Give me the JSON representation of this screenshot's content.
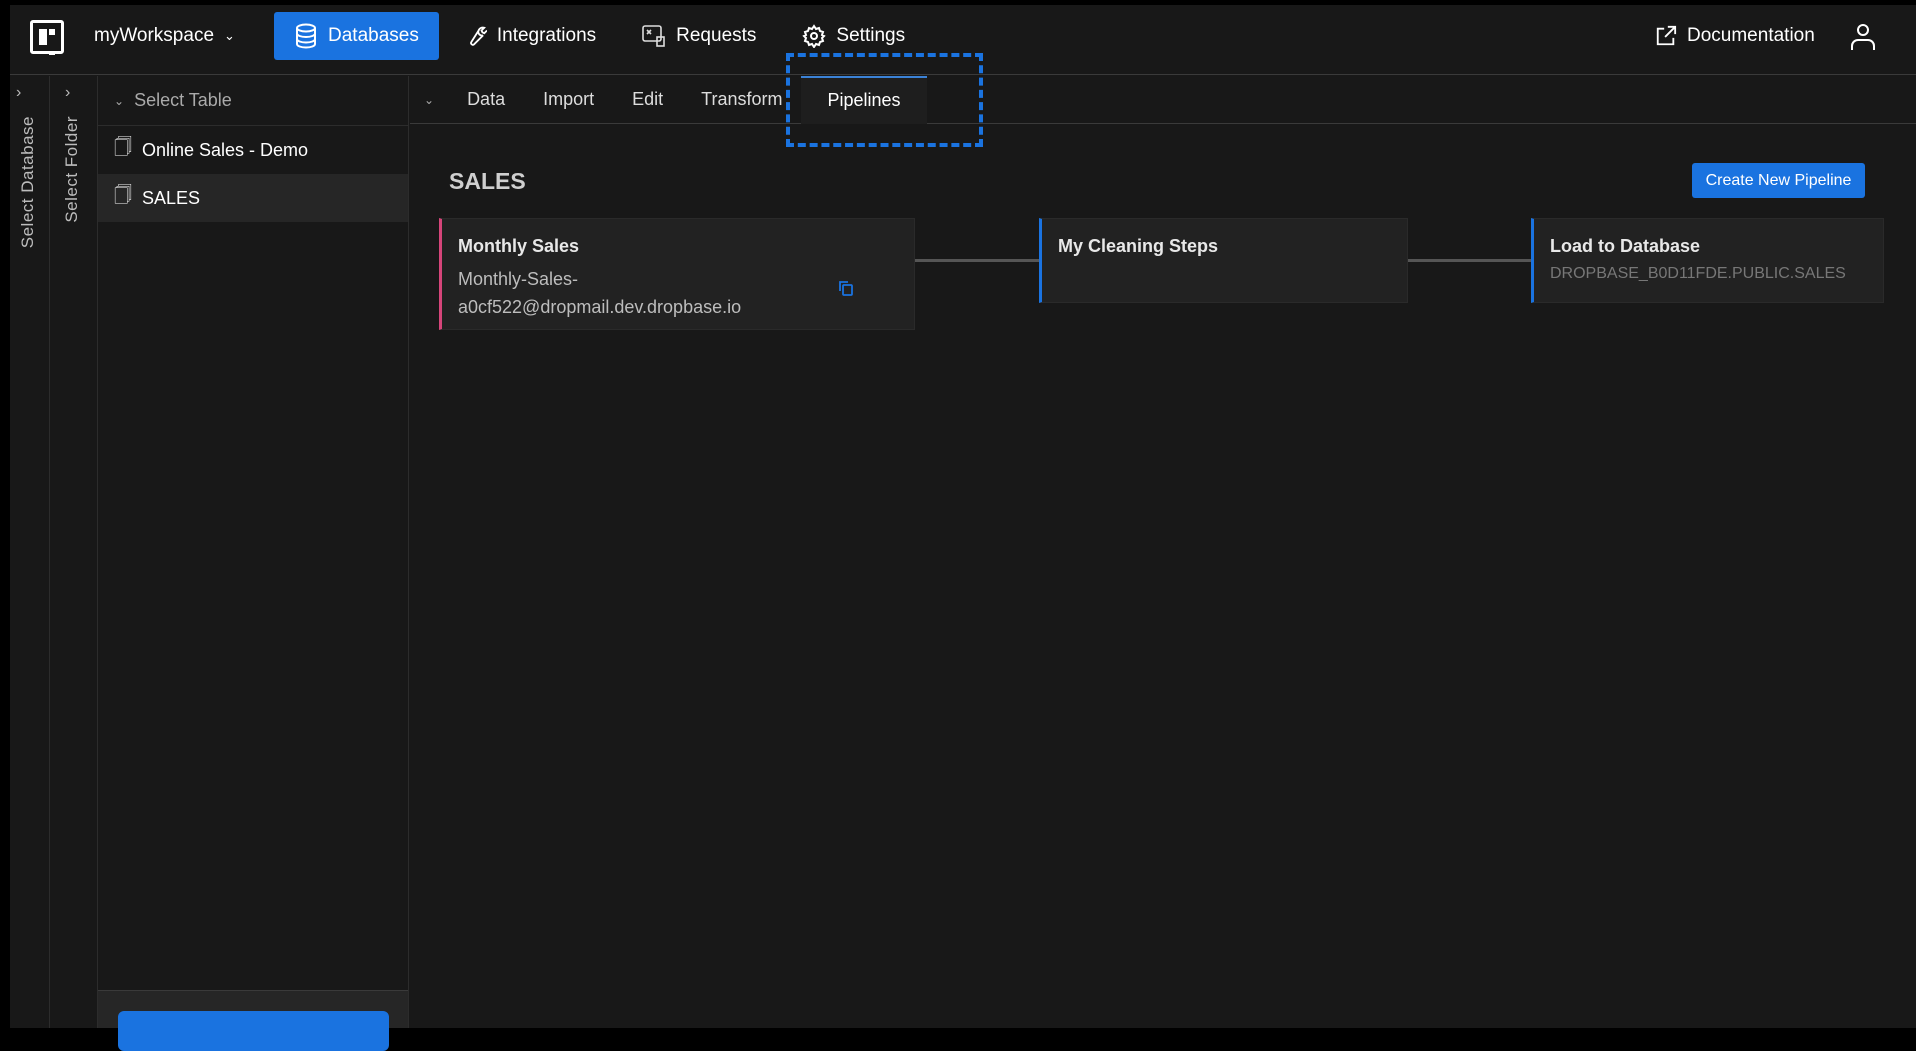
{
  "header": {
    "workspace": "myWorkspace",
    "nav": [
      "Databases",
      "Integrations",
      "Requests",
      "Settings"
    ],
    "documentation": "Documentation"
  },
  "sidebar": {
    "select_database": "Select Database",
    "select_folder": "Select Folder",
    "select_table": "Select Table",
    "tables": [
      "Online Sales - Demo",
      "SALES"
    ]
  },
  "tabs": [
    "Data",
    "Import",
    "Edit",
    "Transform",
    "Pipelines"
  ],
  "main": {
    "title": "SALES",
    "create_button": "Create New Pipeline",
    "source": {
      "title": "Monthly Sales",
      "email_line1": "Monthly-Sales-",
      "email_line2": "a0cf522@dropmail.dev.dropbase.io"
    },
    "transform": {
      "title": "My Cleaning Steps"
    },
    "destination": {
      "title": "Load to Database",
      "target": "DROPBASE_B0D11FDE.PUBLIC.SALES"
    }
  },
  "colors": {
    "accent": "#1a73e0",
    "source_border": "#d6457a",
    "step_border": "#1a73e0"
  }
}
